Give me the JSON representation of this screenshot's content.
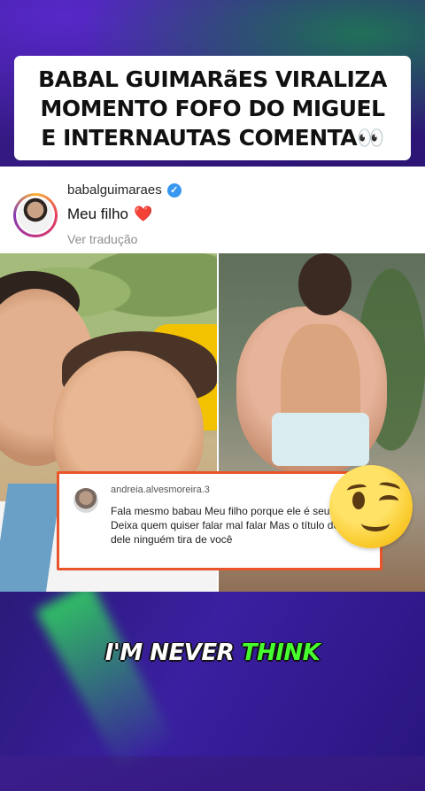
{
  "headline": {
    "lines": [
      "BABAL GUIMARãES VIRALIZA",
      "MOMENTO FOFO DO MIGUEL",
      "E INTERNAUTAS COMENTA👀"
    ]
  },
  "post": {
    "username": "babalguimaraes",
    "verified_icon": "verified-badge-icon",
    "caption": "Meu filho",
    "caption_emoji": "❤️",
    "translate_label": "Ver tradução"
  },
  "comment": {
    "username": "andreia.alvesmoreira.3",
    "text": "Fala mesmo babau Meu filho porque ele é seu filho Deixa quem quiser falar mal falar Mas o título de pai dele ninguém tira de você"
  },
  "subtitle": {
    "text": "I'M NEVER",
    "highlight": "THINK"
  },
  "colors": {
    "comment_border": "#e8552a",
    "subtitle_highlight": "#46ff2e",
    "verified": "#3897f0"
  }
}
